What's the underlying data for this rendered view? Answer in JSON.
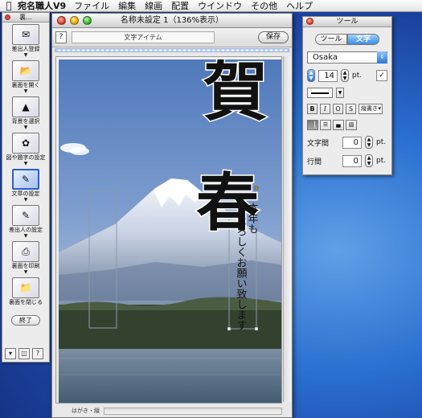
{
  "menubar": {
    "app": "宛名職人V9",
    "items": [
      "ファイル",
      "編集",
      "線画",
      "配置",
      "ウインドウ",
      "その他",
      "ヘルプ"
    ]
  },
  "palette": {
    "title": "裏...",
    "steps": [
      {
        "label": "差出人登録",
        "icon": "card-icon"
      },
      {
        "label": "裏面を開く",
        "icon": "open-back-icon"
      },
      {
        "label": "背景を選択",
        "icon": "background-icon"
      },
      {
        "label": "図や題字の設定",
        "icon": "image-title-icon"
      },
      {
        "label": "文章の設定",
        "icon": "text-setting-icon",
        "selected": true
      },
      {
        "label": "差出人の設定",
        "icon": "sender-setting-icon"
      },
      {
        "label": "裏面を印刷",
        "icon": "printer-icon"
      },
      {
        "label": "裏面を閉じる",
        "icon": "close-back-icon"
      }
    ],
    "end_label": "終了",
    "bottom_help": "?"
  },
  "document": {
    "title": "名称未設定 1（136%表示）",
    "help": "?",
    "mode": "文字アイテム",
    "save": "保存",
    "status": "はがき・縦",
    "card_text": {
      "title_chars": [
        "賀",
        "春"
      ],
      "line1": "本年も",
      "line2": "よろしくお願い致します"
    }
  },
  "tools": {
    "title": "ツール",
    "tabs": [
      "ツール",
      "文字"
    ],
    "active_tab": "文字",
    "font": "Osaka",
    "size": "14",
    "size_unit": "pt.",
    "direction": "縦書き",
    "style_buttons": [
      "B",
      "I",
      "O",
      "S"
    ],
    "char_spacing_label": "文字間",
    "char_spacing": "0",
    "line_spacing_label": "行間",
    "line_spacing": "0",
    "unit": "pt."
  },
  "colors": {
    "accent": "#3b8de8",
    "sky_top": "#5e86c4",
    "lake": "#4e6e88"
  }
}
